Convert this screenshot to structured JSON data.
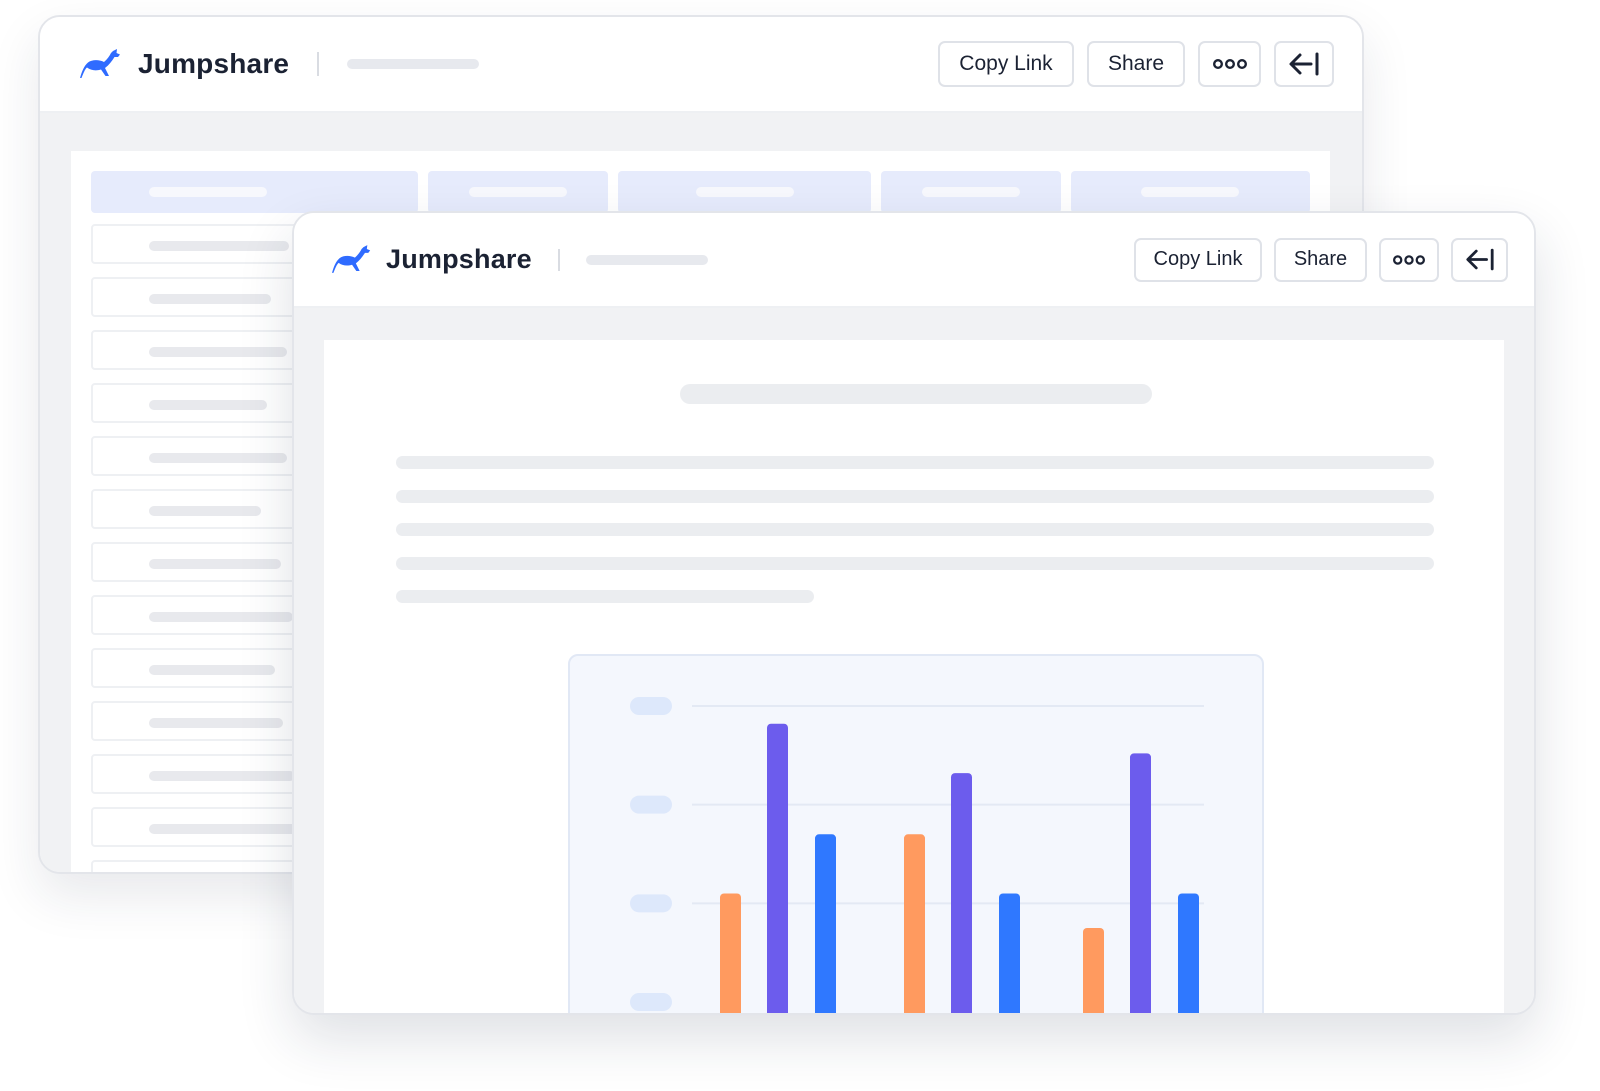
{
  "app": {
    "brand_name": "Jumpshare",
    "brand_color": "#2f6bff",
    "logo_icon": "kangaroo-logo-icon"
  },
  "toolbar": {
    "copy_link_label": "Copy Link",
    "share_label": "Share",
    "more_icon": "more-dots-icon",
    "collapse_icon": "arrow-left-bar-icon"
  },
  "document": {
    "type": "document-preview-with-chart"
  },
  "chart_data": {
    "type": "bar",
    "categories": [
      "",
      "",
      ""
    ],
    "series": [
      {
        "color": "#ff9a5f",
        "values": [
          1.1,
          1.7,
          0.75
        ]
      },
      {
        "color": "#6c5ced",
        "values": [
          2.82,
          2.32,
          2.52
        ]
      },
      {
        "color": "#2f78ff",
        "values": [
          1.7,
          1.1,
          1.1
        ]
      }
    ],
    "ylim": [
      0,
      3
    ],
    "grid": true,
    "tick_labels_visible": false,
    "legend": "none"
  }
}
